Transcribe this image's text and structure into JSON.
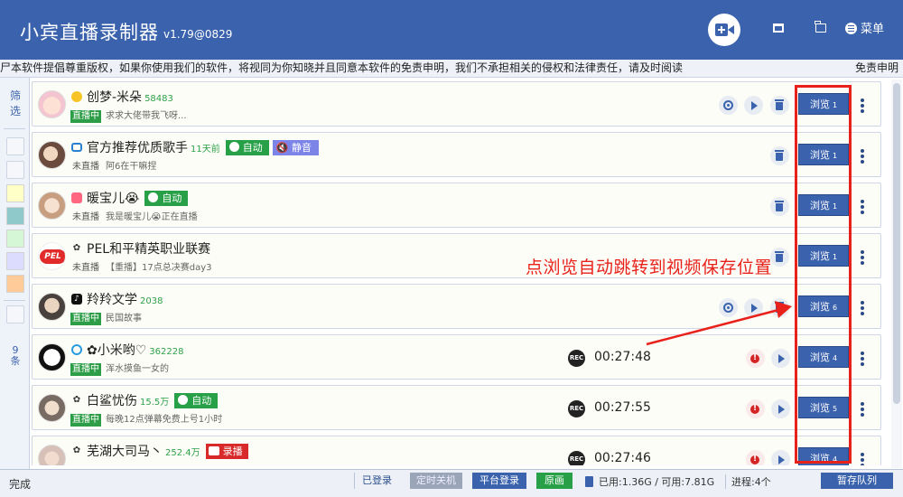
{
  "app": {
    "title": "小宾直播录制器",
    "version": "v1.79@0829",
    "menu_label": "菜单"
  },
  "disclaimer": {
    "text": "尸本软件提倡尊重版权，如果你使用我们的软件，将视同为你知晓并且同意本软件的免责申明，我们不承担相关的侵权和法律责任，请及时阅读",
    "link": "免责申明"
  },
  "sidebar": {
    "filter_label": "筛选",
    "count_label": "9条"
  },
  "rows": [
    {
      "name": "创梦-米朵",
      "fans": "58483",
      "platform_icon": "yellow-circle-icon",
      "tag_auto": "",
      "tag_mute": "",
      "tag_rec": "",
      "status": "直播中",
      "live": true,
      "room_title": "求求大佬带我飞呀...",
      "rec_time": "",
      "browse": "浏览",
      "browse_count": "1"
    },
    {
      "name": "官方推荐优质歌手",
      "fans": "11天前",
      "platform_icon": "tv-icon",
      "tag_auto": "自动",
      "tag_mute": "静音",
      "tag_rec": "",
      "status": "未直播",
      "live": false,
      "room_title": "阿6在干嘛捏",
      "rec_time": "",
      "browse": "浏览",
      "browse_count": "1"
    },
    {
      "name": "暖宝儿😭",
      "fans": "",
      "platform_icon": "pink-icon",
      "tag_auto": "自动",
      "tag_mute": "",
      "tag_rec": "",
      "status": "未直播",
      "live": false,
      "room_title": "我是暖宝儿😭正在直播",
      "rec_time": "",
      "browse": "浏览",
      "browse_count": "1"
    },
    {
      "name": "PEL和平精英职业联赛",
      "fans": "",
      "platform_icon": "bear-icon",
      "tag_auto": "",
      "tag_mute": "",
      "tag_rec": "",
      "status": "未直播",
      "live": false,
      "room_title": "【重播】17点总决赛day3",
      "rec_time": "",
      "browse": "浏览",
      "browse_count": "1"
    },
    {
      "name": "羚羚文学",
      "fans": "2038",
      "platform_icon": "douyin-icon",
      "tag_auto": "",
      "tag_mute": "",
      "tag_rec": "",
      "status": "直播中",
      "live": true,
      "room_title": "民国故事",
      "rec_time": "",
      "browse": "浏览",
      "browse_count": "6"
    },
    {
      "name": "小米哟♡",
      "fans": "362228",
      "platform_icon": "blue-ring-icon",
      "tag_auto": "",
      "tag_mute": "",
      "tag_rec": "",
      "status": "直播中",
      "live": true,
      "room_title": "浑水摸鱼一女的",
      "rec_time": "00:27:48",
      "browse": "浏览",
      "browse_count": "4"
    },
    {
      "name": "白鲨忧伤",
      "fans": "15.5万",
      "platform_icon": "bear-icon",
      "tag_auto": "自动",
      "tag_mute": "",
      "tag_rec": "",
      "status": "直播中",
      "live": true,
      "room_title": "每晚12点弹幕免费上号1小时",
      "rec_time": "00:27:55",
      "browse": "浏览",
      "browse_count": "5"
    },
    {
      "name": "芜湖大司马丶",
      "fans": "252.4万",
      "platform_icon": "bear-icon",
      "tag_auto": "",
      "tag_mute": "",
      "tag_rec": "录播",
      "status": "",
      "live": true,
      "room_title": "",
      "rec_time": "00:27:46",
      "browse": "浏览",
      "browse_count": "4"
    }
  ],
  "annotation": {
    "text": "点浏览自动跳转到视频保存位置"
  },
  "statusbar": {
    "status": "完成",
    "logged_in": "已登录",
    "timer_shutdown": "定时关机",
    "platform_login": "平台登录",
    "original_quality": "原画",
    "disk": "已用:1.36G / 可用:7.81G",
    "process": "进程:4个",
    "pause_queue": "暂存队列"
  },
  "colors": {
    "primary": "#3b63ad",
    "live_green": "#2d9d47",
    "annotation_red": "#e8221b"
  }
}
